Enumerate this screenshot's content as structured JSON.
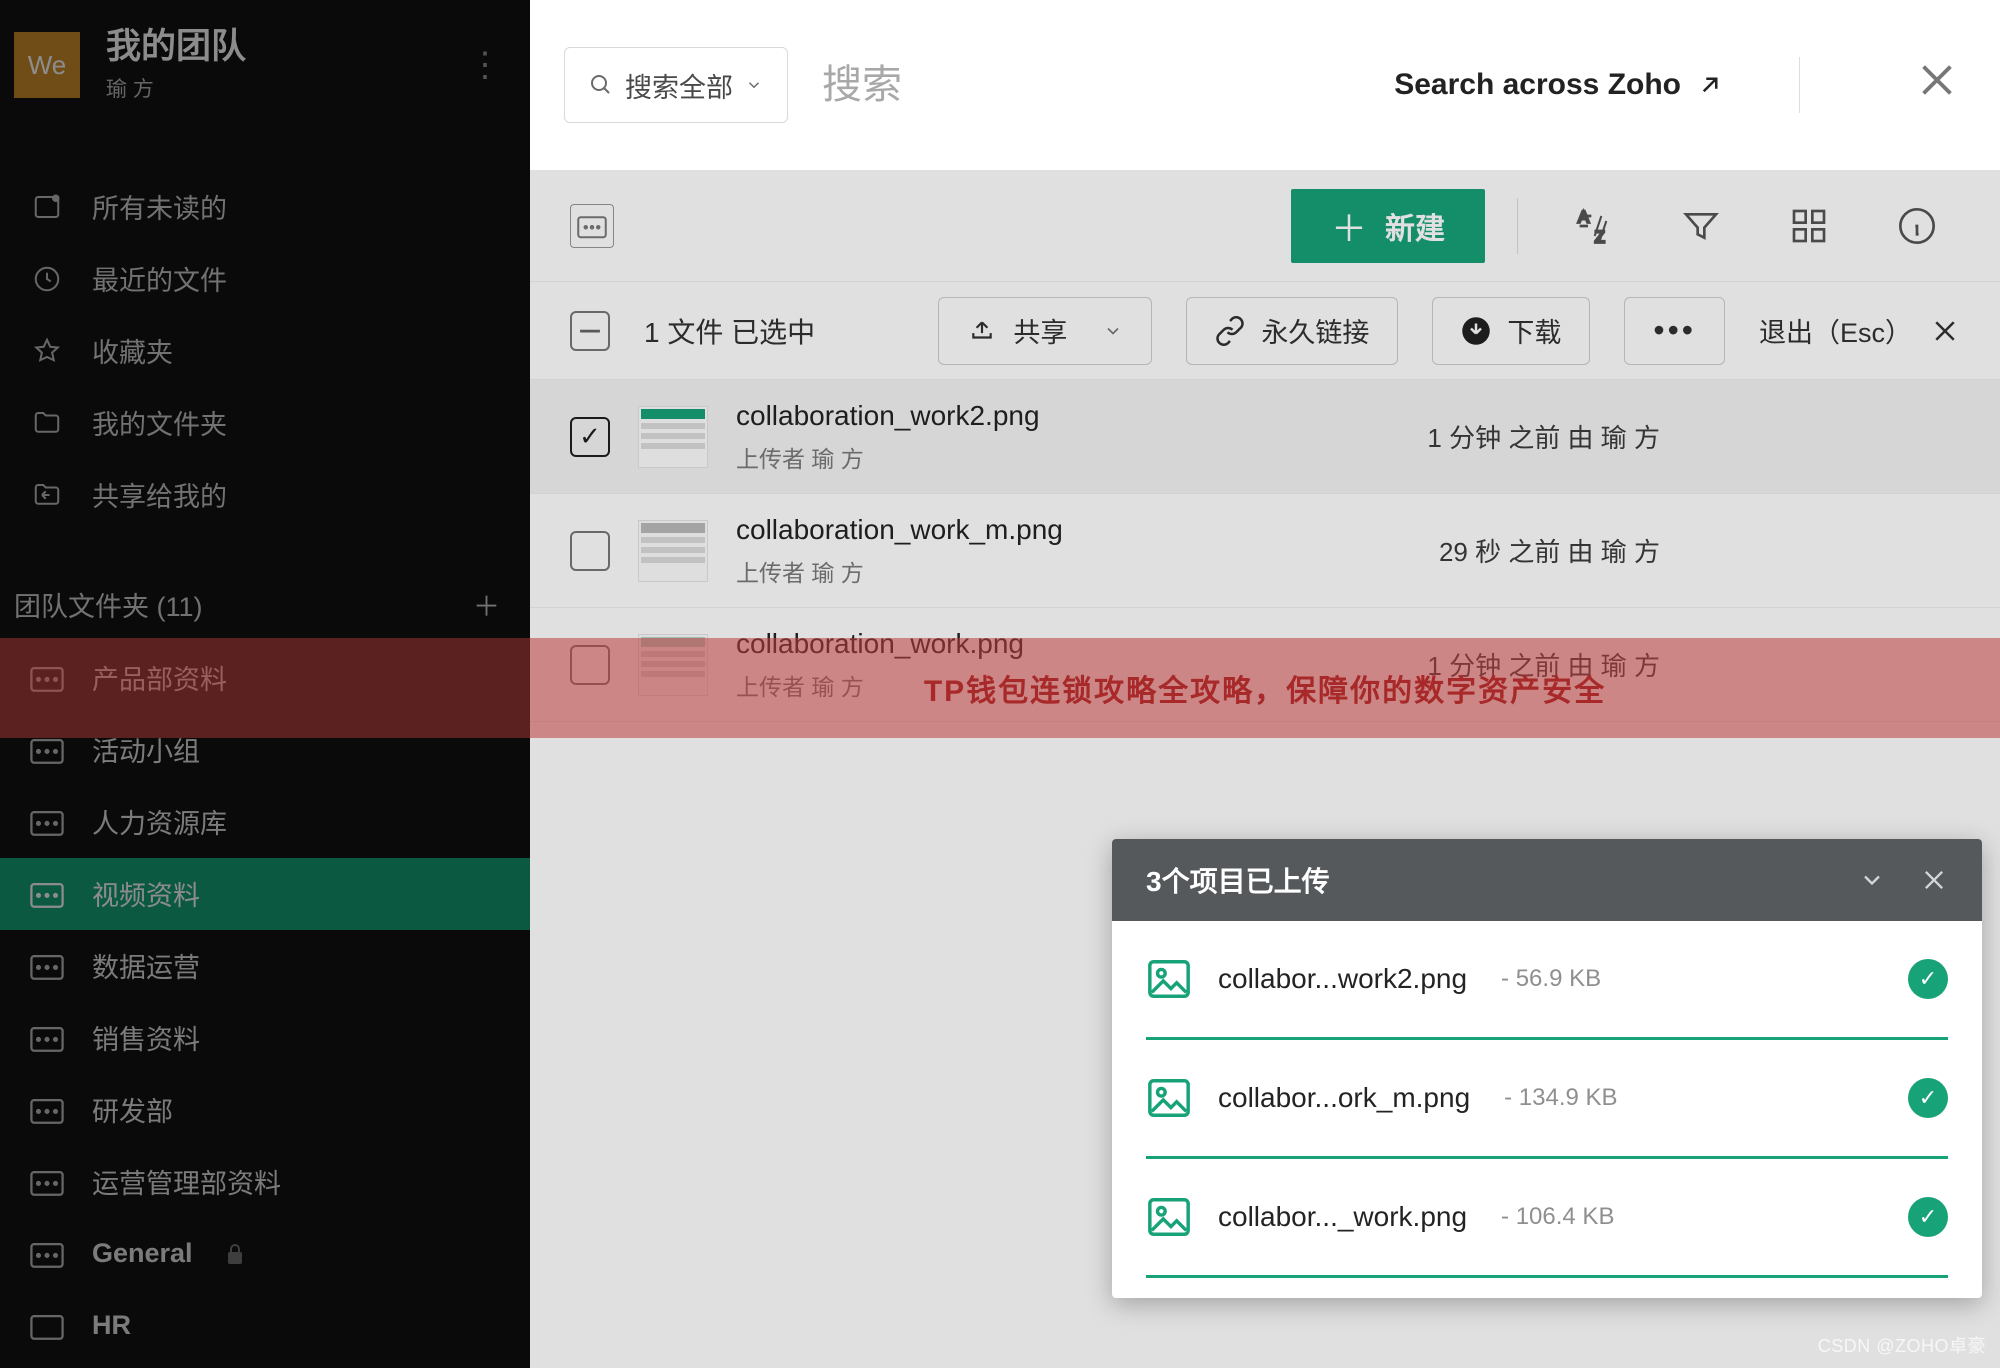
{
  "sidebar": {
    "logo_text": "We",
    "title": "我的团队",
    "subtitle": "瑜 方",
    "nav": [
      {
        "label": "所有未读的",
        "icon": "inbox"
      },
      {
        "label": "最近的文件",
        "icon": "clock"
      },
      {
        "label": "收藏夹",
        "icon": "star"
      },
      {
        "label": "我的文件夹",
        "icon": "folder"
      },
      {
        "label": "共享给我的",
        "icon": "share-in"
      }
    ],
    "section_title": "团队文件夹 (11)",
    "folders": [
      {
        "label": "产品部资料"
      },
      {
        "label": "活动小组"
      },
      {
        "label": "人力资源库"
      },
      {
        "label": "视频资料",
        "active": true
      },
      {
        "label": "数据运营"
      },
      {
        "label": "销售资料"
      },
      {
        "label": "研发部"
      },
      {
        "label": "运营管理部资料"
      },
      {
        "label": "General",
        "locked": true
      },
      {
        "label": "HR"
      }
    ]
  },
  "search": {
    "filter_label": "搜索全部",
    "placeholder": "搜索",
    "zoho_label": "Search across Zoho"
  },
  "toolbar": {
    "new_label": "新建"
  },
  "selection": {
    "count_text": "1 文件 已选中",
    "share_label": "共享",
    "permalink_label": "永久链接",
    "download_label": "下载",
    "exit_label": "退出（Esc）"
  },
  "files": [
    {
      "name": "collaboration_work2.png",
      "uploader": "上传者 瑜 方",
      "time": "1 分钟 之前 由 瑜 方",
      "checked": true
    },
    {
      "name": "collaboration_work_m.png",
      "uploader": "上传者 瑜 方",
      "time": "29 秒 之前 由 瑜 方",
      "checked": false
    },
    {
      "name": "collaboration_work.png",
      "uploader": "上传者 瑜 方",
      "time": "1 分钟 之前 由 瑜 方",
      "checked": false
    }
  ],
  "banner_text": "TP钱包连锁攻略全攻略，保障你的数字资产安全",
  "upload": {
    "title": "3个项目已上传",
    "items": [
      {
        "name": "collabor...work2.png",
        "size": "- 56.9 KB"
      },
      {
        "name": "collabor...ork_m.png",
        "size": "- 134.9 KB"
      },
      {
        "name": "collabor..._work.png",
        "size": "- 106.4 KB"
      }
    ]
  },
  "watermark": "CSDN @ZOHO卓豪"
}
